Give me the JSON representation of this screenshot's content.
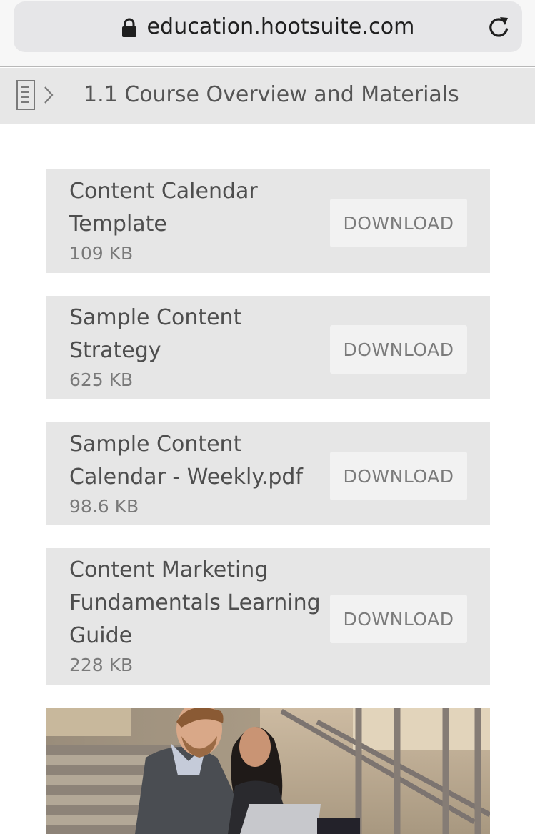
{
  "browser": {
    "url": "education.hootsuite.com",
    "lock_icon": "lock-icon",
    "reload_icon": "reload-icon"
  },
  "course": {
    "title": "1.1 Course Overview and Materials",
    "toc_icon": "table-of-contents-icon"
  },
  "materials": [
    {
      "name": "Content Calendar Template",
      "size": "109 KB",
      "action": "DOWNLOAD"
    },
    {
      "name": "Sample Content Strategy",
      "size": "625 KB",
      "action": "DOWNLOAD"
    },
    {
      "name": "Sample Content Calendar - Weekly.pdf",
      "size": "98.6 KB",
      "action": "DOWNLOAD"
    },
    {
      "name": "Content Marketing Fundamentals Learning Guide",
      "size": "228 KB",
      "action": "DOWNLOAD"
    }
  ],
  "colors": {
    "address_bar": "#e6e6e8",
    "course_header": "#e7e7e7",
    "card": "#e6e6e6",
    "button": "#f2f2f2"
  }
}
